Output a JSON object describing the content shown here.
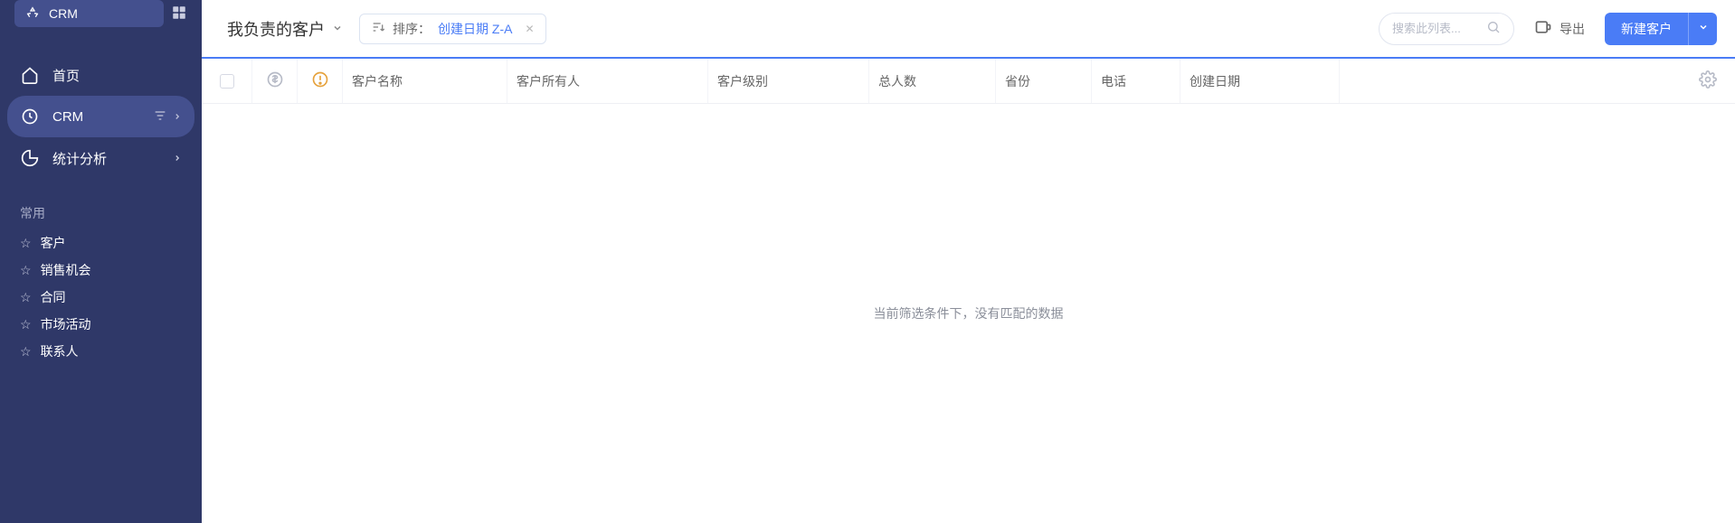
{
  "sidebar": {
    "brand": "CRM",
    "nav": [
      {
        "label": "首页"
      },
      {
        "label": "CRM"
      },
      {
        "label": "统计分析"
      }
    ],
    "favorites_header": "常用",
    "favorites": [
      {
        "label": "客户"
      },
      {
        "label": "销售机会"
      },
      {
        "label": "合同"
      },
      {
        "label": "市场活动"
      },
      {
        "label": "联系人"
      }
    ]
  },
  "toolbar": {
    "view_title": "我负责的客户",
    "sort_prefix": "排序：",
    "sort_value": "创建日期 Z-A",
    "search_placeholder": "搜索此列表...",
    "export_label": "导出",
    "new_label": "新建客户"
  },
  "table": {
    "columns": {
      "name": "客户名称",
      "owner": "客户所有人",
      "level": "客户级别",
      "count": "总人数",
      "province": "省份",
      "phone": "电话",
      "created": "创建日期"
    },
    "rows": []
  },
  "empty_message": "当前筛选条件下，没有匹配的数据"
}
